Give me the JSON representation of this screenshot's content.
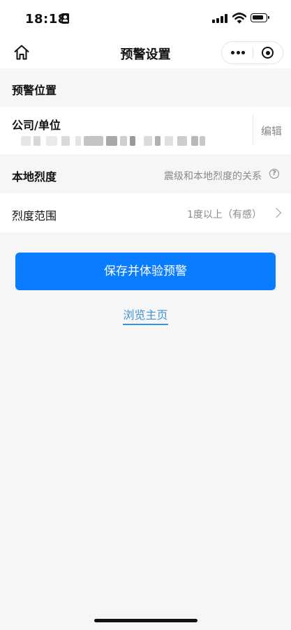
{
  "status_bar": {
    "time": "18:18",
    "icons": [
      "id-card-icon",
      "signal-icon",
      "wifi-icon",
      "battery-icon"
    ]
  },
  "nav": {
    "title": "预警设置",
    "icons": [
      "home-icon",
      "more-icon",
      "target-icon"
    ]
  },
  "location_section": {
    "header": "预警位置",
    "company_label": "公司/单位",
    "edit_label": "编辑"
  },
  "intensity_section": {
    "header": "本地烈度",
    "help_text": "震级和本地烈度的关系",
    "help_icon": "question-circle-icon"
  },
  "range_row": {
    "label": "烈度范围",
    "value": "1度以上（有感）"
  },
  "actions": {
    "save_label": "保存并体验预警",
    "browse_label": "浏览主页"
  },
  "colors": {
    "primary": "#0a7cff",
    "link": "#3a93d8",
    "background": "#f6f6f6",
    "muted_text": "#8a8a8a"
  }
}
